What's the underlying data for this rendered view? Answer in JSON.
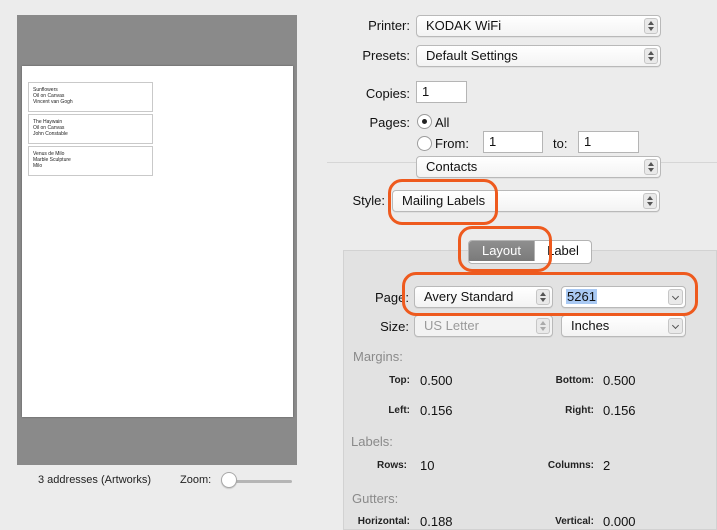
{
  "preview": {
    "labels": [
      [
        "Sunflowers",
        "Oil on Canvas",
        "Vincent van Gogh"
      ],
      [
        "The Haywain",
        "Oil on Canvas",
        "John Constable"
      ],
      [
        "Venus de Milo",
        "Marble Sculpture",
        "Milo"
      ]
    ],
    "address_count": "3 addresses (Artworks)",
    "zoom_label": "Zoom:"
  },
  "printer": {
    "label": "Printer:",
    "value": "KODAK WiFi"
  },
  "presets": {
    "label": "Presets:",
    "value": "Default Settings"
  },
  "copies": {
    "label": "Copies:",
    "value": "1"
  },
  "pages": {
    "label": "Pages:",
    "all_label": "All",
    "from_label": "From:",
    "from_value": "1",
    "to_label": "to:",
    "to_value": "1"
  },
  "app_menu": {
    "value": "Contacts"
  },
  "style": {
    "label": "Style:",
    "value": "Mailing Labels"
  },
  "tabs": {
    "layout": "Layout",
    "label": "Label"
  },
  "layout": {
    "page_label": "Page:",
    "page_value": "Avery Standard",
    "page_code": "5261",
    "size_label": "Size:",
    "size_value": "US Letter",
    "units_value": "Inches",
    "margins_header": "Margins:",
    "top_label": "Top:",
    "top_value": "0.500",
    "bottom_label": "Bottom:",
    "bottom_value": "0.500",
    "left_label": "Left:",
    "left_value": "0.156",
    "right_label": "Right:",
    "right_value": "0.156",
    "labels_header": "Labels:",
    "rows_label": "Rows:",
    "rows_value": "10",
    "columns_label": "Columns:",
    "columns_value": "2",
    "gutters_header": "Gutters:",
    "horizontal_label": "Horizontal:",
    "horizontal_value": "0.188",
    "vertical_label": "Vertical:",
    "vertical_value": "0.000"
  },
  "colors": {
    "highlight": "#ee5a1e",
    "selected_tab": "#808080",
    "text_selection": "#a9c9f3"
  }
}
